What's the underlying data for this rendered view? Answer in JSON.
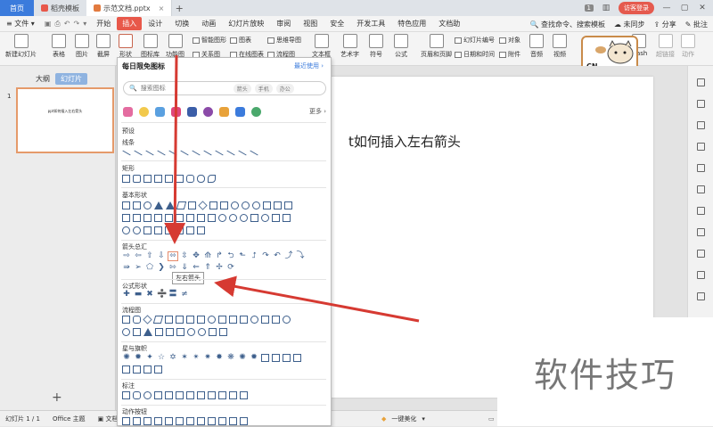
{
  "tabbar": {
    "home": "首页",
    "tab1": "稻壳模板",
    "tab2": "示范文档.pptx",
    "badge": "1",
    "login": "访客登录"
  },
  "menubar": {
    "file": "文件",
    "items": [
      "开始",
      "插入",
      "设计",
      "切换",
      "动画",
      "幻灯片放映",
      "审阅",
      "视图",
      "安全",
      "开发工具",
      "特色应用",
      "文档助"
    ],
    "active_index": 1,
    "search_placeholder": "查找命令、搜索模板",
    "sync": "未同步",
    "share": "分享",
    "annotate": "批注"
  },
  "ribbon": {
    "new_slide": "新建幻灯片",
    "table": "表格",
    "picture": "图片",
    "screenshot": "截屏",
    "shape": "形状",
    "icon_lib": "图标库",
    "function_chart": "功能图",
    "smart_graphic": "智能图形",
    "chart": "图表",
    "mind_map": "思维导图",
    "relation_graph": "关系图",
    "online_chart": "在线图表",
    "flowchart": "流程图",
    "textbox": "文本框",
    "art_text": "艺术字",
    "symbol": "符号",
    "formula": "公式",
    "header_footer": "页眉和页脚",
    "slide_number": "幻灯片编号",
    "object": "对象",
    "date_time": "日期和时间",
    "attachment": "附件",
    "audio": "音频",
    "video": "视频",
    "flash": "Flash",
    "hyperlink": "超链接",
    "action": "动作"
  },
  "left_panel": {
    "outline_tab": "大纲",
    "slides_tab": "幻灯片",
    "slide_number": "1",
    "thumb_text": "ppt如何插入左右箭头",
    "add": "+"
  },
  "slide": {
    "title_visible": "t如何插入左右箭头"
  },
  "dropdown": {
    "header": "每日限免图标",
    "recent": "最近使用",
    "search_placeholder": "搜索图标",
    "chips": [
      "箭头",
      "手机",
      "办公"
    ],
    "more": "更多",
    "sections": {
      "preset": "预设",
      "lines": "线条",
      "rect": "矩形",
      "basic": "基本形状",
      "arrows": "箭头总汇",
      "formula": "公式形状",
      "flow": "流程图",
      "stars": "星与旗帜",
      "callouts": "标注",
      "actions": "动作按钮"
    },
    "tooltip": "左右箭头"
  },
  "sticker": {
    "text": "CN"
  },
  "statusbar": {
    "slide_info": "幻灯片 1 / 1",
    "theme": "Office 主题",
    "doc": "文档未",
    "beautify": "一键美化"
  },
  "watermark": "软件技巧",
  "colors": {
    "accent": "#e8584a",
    "home_tab": "#3b7bdc",
    "arrow": "#d63a32"
  }
}
